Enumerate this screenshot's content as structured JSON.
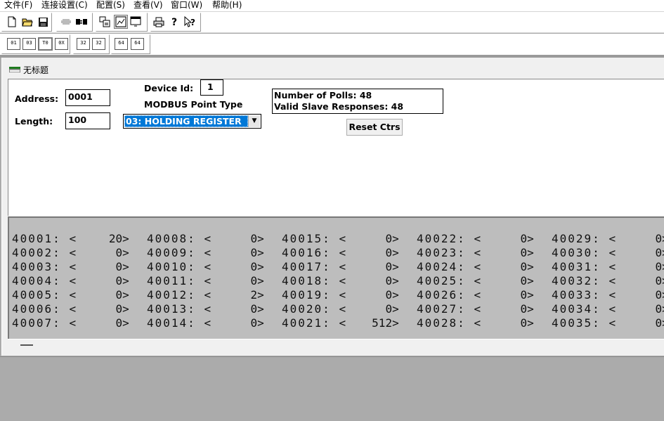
{
  "menu": [
    "文件(F)",
    "连接设置(C)",
    "配置(S)",
    "查看(V)",
    "窗口(W)",
    "帮助(H)"
  ],
  "toolbar_icons": [
    "new-file-icon",
    "open-folder-icon",
    "save-icon",
    "disconnect-icon",
    "connect-icon",
    "display-icon",
    "graph-icon",
    "window-icon",
    "print-icon",
    "help-icon",
    "context-help-icon"
  ],
  "display_buttons": [
    "01",
    "03",
    "T0",
    "0X",
    "32",
    "32",
    "64",
    "64"
  ],
  "window": {
    "title": "无标题"
  },
  "form": {
    "address_label": "Address:",
    "address_value": "0001",
    "length_label": "Length:",
    "length_value": "100",
    "device_id_label": "Device Id:",
    "device_id_value": "1",
    "point_type_label": "MODBUS Point Type",
    "point_type_value": "03: HOLDING REGISTER",
    "polls_text": "Number of Polls: 48",
    "responses_text": "Valid Slave Responses: 48",
    "reset_label": "Reset Ctrs"
  },
  "registers": [
    [
      [
        "40001",
        "20"
      ],
      [
        "40002",
        "0"
      ],
      [
        "40003",
        "0"
      ],
      [
        "40004",
        "0"
      ],
      [
        "40005",
        "0"
      ],
      [
        "40006",
        "0"
      ],
      [
        "40007",
        "0"
      ]
    ],
    [
      [
        "40008",
        "0"
      ],
      [
        "40009",
        "0"
      ],
      [
        "40010",
        "0"
      ],
      [
        "40011",
        "0"
      ],
      [
        "40012",
        "2"
      ],
      [
        "40013",
        "0"
      ],
      [
        "40014",
        "0"
      ]
    ],
    [
      [
        "40015",
        "0"
      ],
      [
        "40016",
        "0"
      ],
      [
        "40017",
        "0"
      ],
      [
        "40018",
        "0"
      ],
      [
        "40019",
        "0"
      ],
      [
        "40020",
        "0"
      ],
      [
        "40021",
        "512"
      ]
    ],
    [
      [
        "40022",
        "0"
      ],
      [
        "40023",
        "0"
      ],
      [
        "40024",
        "0"
      ],
      [
        "40025",
        "0"
      ],
      [
        "40026",
        "0"
      ],
      [
        "40027",
        "0"
      ],
      [
        "40028",
        "0"
      ]
    ],
    [
      [
        "40029",
        "0"
      ],
      [
        "40030",
        "0"
      ],
      [
        "40031",
        "0"
      ],
      [
        "40032",
        "0"
      ],
      [
        "40033",
        "0"
      ],
      [
        "40034",
        "0"
      ],
      [
        "40035",
        "0"
      ]
    ]
  ]
}
